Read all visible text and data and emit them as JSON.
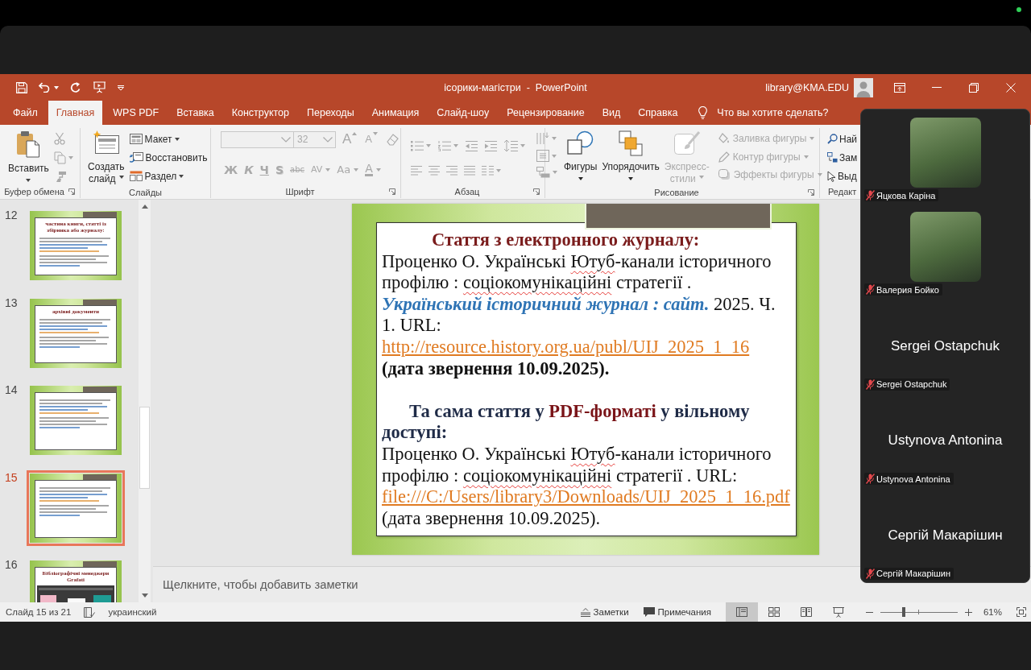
{
  "window": {
    "title": "ісорики-магістри  -  PowerPoint",
    "account": "library@KMA.EDU"
  },
  "tabs": [
    {
      "label": "Файл",
      "selected": false
    },
    {
      "label": "Главная",
      "selected": true
    },
    {
      "label": "WPS PDF",
      "selected": false
    },
    {
      "label": "Вставка",
      "selected": false
    },
    {
      "label": "Конструктор",
      "selected": false
    },
    {
      "label": "Переходы",
      "selected": false
    },
    {
      "label": "Анимация",
      "selected": false
    },
    {
      "label": "Слайд-шоу",
      "selected": false
    },
    {
      "label": "Рецензирование",
      "selected": false
    },
    {
      "label": "Вид",
      "selected": false
    },
    {
      "label": "Справка",
      "selected": false
    }
  ],
  "tell_me": {
    "placeholder": "Что вы хотите сделать?"
  },
  "ribbon": {
    "clipboard": {
      "label": "Буфер обмена",
      "paste": "Вставить",
      "tools_disabled": true
    },
    "slides": {
      "label": "Слайды",
      "new_slide": [
        "Создать",
        "слайд"
      ],
      "commands": [
        {
          "kind": "layout",
          "label": "Макет",
          "dropdown": true
        },
        {
          "kind": "reset",
          "label": "Восстановить",
          "dropdown": false
        },
        {
          "kind": "section",
          "label": "Раздел",
          "dropdown": true
        }
      ]
    },
    "font": {
      "label": "Шрифт",
      "disabled": true,
      "size": "32",
      "size_buttons": [
        {
          "kind": "grow",
          "label": "A"
        },
        {
          "kind": "shrink",
          "label": "A"
        }
      ],
      "format_buttons": [
        {
          "kind": "bold",
          "label": "Ж",
          "dropdown": false
        },
        {
          "kind": "italic",
          "label": "К",
          "dropdown": false
        },
        {
          "kind": "underline",
          "label": "Ч",
          "dropdown": false
        },
        {
          "kind": "shadow",
          "label": "S",
          "dropdown": false
        },
        {
          "kind": "strike",
          "label": "abc",
          "dropdown": false
        },
        {
          "kind": "spacing",
          "label": "AV",
          "dropdown": true
        },
        {
          "kind": "case",
          "label": "Aa",
          "dropdown": true
        },
        {
          "kind": "color",
          "label": "A",
          "dropdown": true
        }
      ]
    },
    "paragraph": {
      "label": "Абзац",
      "disabled": true
    },
    "drawing": {
      "label": "Рисование",
      "large": [
        {
          "kind": "shapes",
          "lines": [
            "Фигуры"
          ],
          "disabled": false
        },
        {
          "kind": "arrange",
          "lines": [
            "Упорядочить"
          ],
          "disabled": false
        },
        {
          "kind": "styles",
          "lines": [
            "Экспресс-",
            "стили"
          ],
          "disabled": true
        }
      ],
      "commands": [
        {
          "kind": "fill",
          "label": "Заливка фигуры",
          "disabled": true
        },
        {
          "kind": "outline",
          "label": "Контур фигуры",
          "disabled": true
        },
        {
          "kind": "effects",
          "label": "Эффекты фигуры",
          "disabled": true
        }
      ]
    },
    "editing": {
      "label": "Редакт",
      "commands": [
        {
          "kind": "find",
          "label": "Най"
        },
        {
          "kind": "replace",
          "label": "Зам"
        },
        {
          "kind": "select",
          "label": "Выд"
        }
      ]
    }
  },
  "thumbnails": [
    {
      "number": "12",
      "kind": "text",
      "title": "частина книги, статті із збірника або журналу:",
      "selected": false
    },
    {
      "number": "13",
      "kind": "text",
      "title": "архівні документи",
      "selected": false
    },
    {
      "number": "14",
      "kind": "text",
      "selected": false
    },
    {
      "number": "15",
      "kind": "text",
      "selected": true
    },
    {
      "number": "16",
      "kind": "picture",
      "title": "Бібліографічні менеджери Grafati",
      "selected": false
    }
  ],
  "slide": {
    "paragraphs": [
      {
        "kind": "heading",
        "runs": [
          {
            "kind": "plain",
            "text": "Стаття з електронного журналу:"
          }
        ]
      },
      {
        "kind": "body",
        "runs": [
          {
            "kind": "plain",
            "text": "Проценко О. Українські "
          },
          {
            "kind": "misspelled",
            "text": "Ютуб"
          },
          {
            "kind": "plain",
            "text": "-канали історичного профілю : "
          },
          {
            "kind": "misspelled",
            "text": "соціокомунікаційні"
          },
          {
            "kind": "plain",
            "text": " стратегії . "
          },
          {
            "kind": "journal",
            "text": "Український історичний журнал : сайт."
          },
          {
            "kind": "plain",
            "text": " 2025. Ч. 1. URL: "
          },
          {
            "kind": "link",
            "text": "http://resource.history.org.ua/publ/UIJ_2025_1_16"
          },
          {
            "kind": "bold",
            "text": " (дата звернення 10.09.2025)."
          }
        ]
      },
      {
        "kind": "subheading",
        "runs": [
          {
            "kind": "plain",
            "text": "Та сама стаття у "
          },
          {
            "kind": "accent",
            "text": "PDF-форматі"
          },
          {
            "kind": "plain",
            "text": " у вільному доступі:"
          }
        ]
      },
      {
        "kind": "body",
        "runs": [
          {
            "kind": "plain",
            "text": "Проценко О. Українські "
          },
          {
            "kind": "misspelled",
            "text": "Ютуб"
          },
          {
            "kind": "plain",
            "text": "-канали історичного профілю : "
          },
          {
            "kind": "misspelled",
            "text": "соціокомунікаційні"
          },
          {
            "kind": "plain",
            "text": " стратегії . URL: "
          },
          {
            "kind": "link",
            "text": "file:///C:/Users/library3/Downloads/UIJ_2025_1_16.pdf"
          },
          {
            "kind": "plain",
            "text": " (дата звернення 10.09.2025)."
          }
        ]
      }
    ]
  },
  "notes": {
    "placeholder": "Щелкните, чтобы добавить заметки"
  },
  "status_bar": {
    "slide_info": "Слайд 15 из 21",
    "language": "украинский",
    "notes": "Заметки",
    "comments": "Примечания",
    "views": [
      {
        "kind": "normal",
        "selected": true
      },
      {
        "kind": "sorter",
        "selected": false
      },
      {
        "kind": "reading",
        "selected": false
      },
      {
        "kind": "slideshow",
        "selected": false
      }
    ],
    "zoom": {
      "level": 0.3,
      "reading": "61%"
    }
  },
  "participants": [
    {
      "kind": "photo",
      "name": "Яцкова Каріна",
      "muted": true
    },
    {
      "kind": "photo",
      "name": "Валерия Бойко",
      "muted": true
    },
    {
      "kind": "name",
      "display_name": "Sergei Ostapchuk",
      "name": "Sergei Ostapchuk",
      "muted": true
    },
    {
      "kind": "name",
      "display_name": "Ustynova Antonina",
      "name": "Ustynova Antonina",
      "muted": true
    },
    {
      "kind": "name",
      "display_name": "Сергій Макарішин",
      "name": "Сергій Макарішин",
      "muted": true
    }
  ]
}
